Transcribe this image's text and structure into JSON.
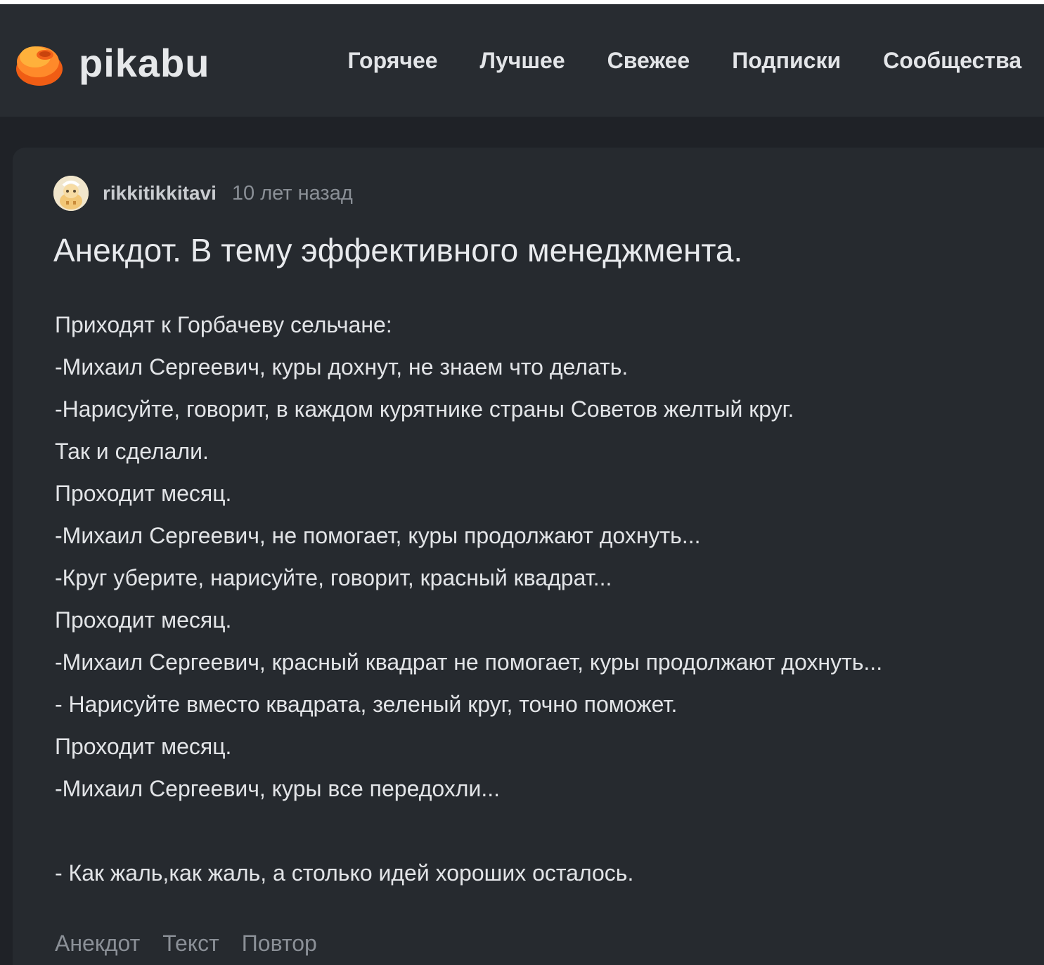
{
  "header": {
    "logo_text": "pikabu",
    "nav": [
      "Горячее",
      "Лучшее",
      "Свежее",
      "Подписки",
      "Сообщества"
    ]
  },
  "post": {
    "author": "rikkitikkitavi",
    "time": "10 лет назад",
    "title": "Анекдот. В тему эффективного менеджмента.",
    "lines": [
      "Приходят к Горбачеву сельчане:",
      "-Михаил Сергеевич, куры дохнут, не знаем что делать.",
      "-Нарисуйте, говорит, в каждом курятнике страны Советов желтый круг.",
      "Так и сделали.",
      "Проходит месяц.",
      "-Михаил Сергеевич, не помогает, куры продолжают дохнуть...",
      "-Круг уберите, нарисуйте, говорит, красный квадрат...",
      "Проходит месяц.",
      "-Михаил Сергеевич, красный квадрат не помогает, куры продолжают дохнуть...",
      "- Нарисуйте вместо квадрата, зеленый круг, точно поможет.",
      "Проходит месяц.",
      "-Михаил Сергеевич, куры все передохли...",
      "",
      "- Как жаль,как жаль, а столько идей хороших осталось."
    ],
    "tags": [
      "Анекдот",
      "Текст",
      "Повтор"
    ]
  },
  "colors": {
    "page_bg": "#1f2227",
    "header_bg": "#282c31",
    "card_bg": "#262a2f",
    "text": "#e2e4e7",
    "muted": "#8a8f96",
    "logo_orange": "#ff6a1a"
  },
  "icons": {
    "logo": "pikabu-logo-icon",
    "avatar": "user-avatar"
  }
}
